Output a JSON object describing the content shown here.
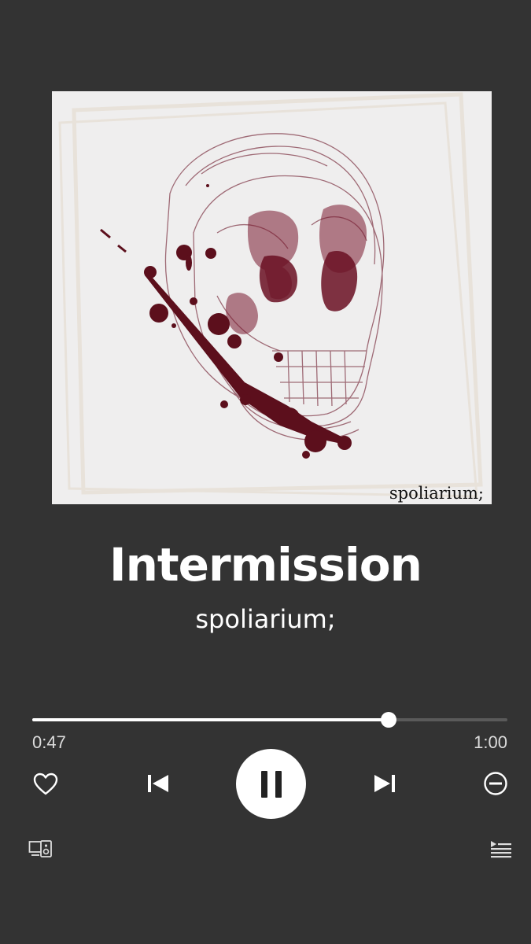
{
  "album_art": {
    "caption": "spoliarium;",
    "icon": "skull-illustration"
  },
  "track": {
    "title": "Intermission",
    "artist": "spoliarium;"
  },
  "playback": {
    "elapsed": "0:47",
    "total": "1:00",
    "progress_fraction": 0.75,
    "state": "playing"
  },
  "controls": {
    "like_icon": "heart-icon",
    "previous_icon": "skip-previous-icon",
    "play_pause_icon": "pause-icon",
    "next_icon": "skip-next-icon",
    "remove_icon": "minus-circle-icon",
    "devices_icon": "devices-icon",
    "queue_icon": "queue-icon"
  },
  "colors": {
    "background": "#333333",
    "blood": "#5c0f1c",
    "skull_line": "#7a3040"
  }
}
